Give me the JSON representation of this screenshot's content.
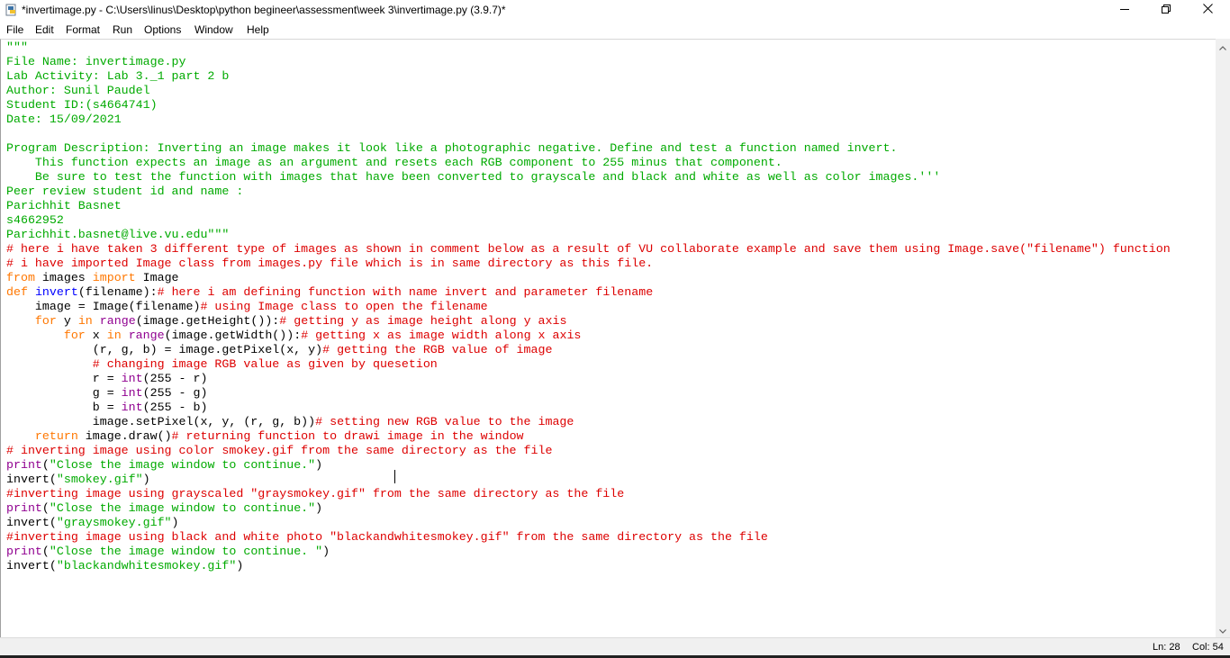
{
  "window": {
    "title": "*invertimage.py - C:\\Users\\linus\\Desktop\\python begineer\\assessment\\week 3\\invertimage.py (3.9.7)*",
    "controls": [
      "minimize-icon",
      "restore-icon",
      "close-icon"
    ]
  },
  "menu": [
    "File",
    "Edit",
    "Format",
    "Run",
    "Options",
    "Window",
    "Help"
  ],
  "syntax_colors": {
    "string": "#00aa00",
    "comment": "#dd0000",
    "keyword": "#ff7700",
    "builtin": "#900090",
    "definition": "#0000ff",
    "default": "#000000"
  },
  "code_lines": [
    [
      [
        "str",
        "\"\"\""
      ]
    ],
    [
      [
        "str",
        "File Name: invertimage.py"
      ]
    ],
    [
      [
        "str",
        "Lab Activity: Lab 3._1 part 2 b"
      ]
    ],
    [
      [
        "str",
        "Author: Sunil Paudel"
      ]
    ],
    [
      [
        "str",
        "Student ID:(s4664741)"
      ]
    ],
    [
      [
        "str",
        "Date: 15/09/2021"
      ]
    ],
    [],
    [
      [
        "str",
        "Program Description: Inverting an image makes it look like a photographic negative. Define and test a function named invert."
      ]
    ],
    [
      [
        "str",
        "    This function expects an image as an argument and resets each RGB component to 255 minus that component."
      ]
    ],
    [
      [
        "str",
        "    Be sure to test the function with images that have been converted to grayscale and black and white as well as color images.'''"
      ]
    ],
    [
      [
        "str",
        "Peer review student id and name :"
      ]
    ],
    [
      [
        "str",
        "Parichhit Basnet"
      ]
    ],
    [
      [
        "str",
        "s4662952"
      ]
    ],
    [
      [
        "str",
        "Parichhit.basnet@live.vu.edu\"\"\""
      ]
    ],
    [
      [
        "cmt",
        "# here i have taken 3 different type of images as shown in comment below as a result of VU collaborate example and save them using Image.save(\"filename\") function"
      ]
    ],
    [
      [
        "cmt",
        "# i have imported Image class from images.py file which is in same directory as this file."
      ]
    ],
    [
      [
        "kw",
        "from"
      ],
      [
        "",
        " images "
      ],
      [
        "kw",
        "import"
      ],
      [
        "",
        " Image"
      ]
    ],
    [
      [
        "kw",
        "def"
      ],
      [
        "",
        " "
      ],
      [
        "fn",
        "invert"
      ],
      [
        "",
        "(filename):"
      ],
      [
        "cmt",
        "# here i am defining function with name invert and parameter filename"
      ]
    ],
    [
      [
        "",
        "    image = Image(filename)"
      ],
      [
        "cmt",
        "# using Image class to open the filename"
      ]
    ],
    [
      [
        "",
        "    "
      ],
      [
        "kw",
        "for"
      ],
      [
        "",
        " y "
      ],
      [
        "kw",
        "in"
      ],
      [
        "",
        " "
      ],
      [
        "bi",
        "range"
      ],
      [
        "",
        "(image.getHeight()):"
      ],
      [
        "cmt",
        "# getting y as image height along y axis"
      ]
    ],
    [
      [
        "",
        "        "
      ],
      [
        "kw",
        "for"
      ],
      [
        "",
        " x "
      ],
      [
        "kw",
        "in"
      ],
      [
        "",
        " "
      ],
      [
        "bi",
        "range"
      ],
      [
        "",
        "(image.getWidth()):"
      ],
      [
        "cmt",
        "# getting x as image width along x axis"
      ]
    ],
    [
      [
        "",
        "            (r, g, b) = image.getPixel(x, y)"
      ],
      [
        "cmt",
        "# getting the RGB value of image"
      ]
    ],
    [
      [
        "",
        "            "
      ],
      [
        "cmt",
        "# changing image RGB value as given by quesetion"
      ]
    ],
    [
      [
        "",
        "            r = "
      ],
      [
        "bi",
        "int"
      ],
      [
        "",
        "(255 - r)"
      ]
    ],
    [
      [
        "",
        "            g = "
      ],
      [
        "bi",
        "int"
      ],
      [
        "",
        "(255 - g)"
      ]
    ],
    [
      [
        "",
        "            b = "
      ],
      [
        "bi",
        "int"
      ],
      [
        "",
        "(255 - b)"
      ]
    ],
    [
      [
        "",
        "            image.setPixel(x, y, (r, g, b))"
      ],
      [
        "cmt",
        "# setting new RGB value to the image"
      ]
    ],
    [
      [
        "",
        "    "
      ],
      [
        "kw",
        "return"
      ],
      [
        "",
        " image.draw()"
      ],
      [
        "cmt",
        "# returning function to drawi image in the window"
      ]
    ],
    [
      [
        "cmt",
        "# inverting image using color smokey.gif from the same directory as the file"
      ]
    ],
    [
      [
        "bi",
        "print"
      ],
      [
        "",
        "("
      ],
      [
        "str",
        "\"Close the image window to continue.\""
      ],
      [
        "",
        ")"
      ]
    ],
    [
      [
        "",
        "invert("
      ],
      [
        "str",
        "\"smokey.gif\""
      ],
      [
        "",
        ")"
      ]
    ],
    [
      [
        "cmt",
        "#inverting image using grayscaled \"graysmokey.gif\" from the same directory as the file"
      ]
    ],
    [
      [
        "bi",
        "print"
      ],
      [
        "",
        "("
      ],
      [
        "str",
        "\"Close the image window to continue.\""
      ],
      [
        "",
        ")"
      ]
    ],
    [
      [
        "",
        "invert("
      ],
      [
        "str",
        "\"graysmokey.gif\""
      ],
      [
        "",
        ")"
      ]
    ],
    [
      [
        "cmt",
        "#inverting image using black and white photo \"blackandwhitesmokey.gif\" from the same directory as the file"
      ]
    ],
    [
      [
        "bi",
        "print"
      ],
      [
        "",
        "("
      ],
      [
        "str",
        "\"Close the image window to continue. \""
      ],
      [
        "",
        ")"
      ]
    ],
    [
      [
        "",
        "invert("
      ],
      [
        "str",
        "\"blackandwhitesmokey.gif\""
      ],
      [
        "",
        ")"
      ]
    ]
  ],
  "status": {
    "line": "Ln: 28",
    "col": "Col: 54"
  }
}
